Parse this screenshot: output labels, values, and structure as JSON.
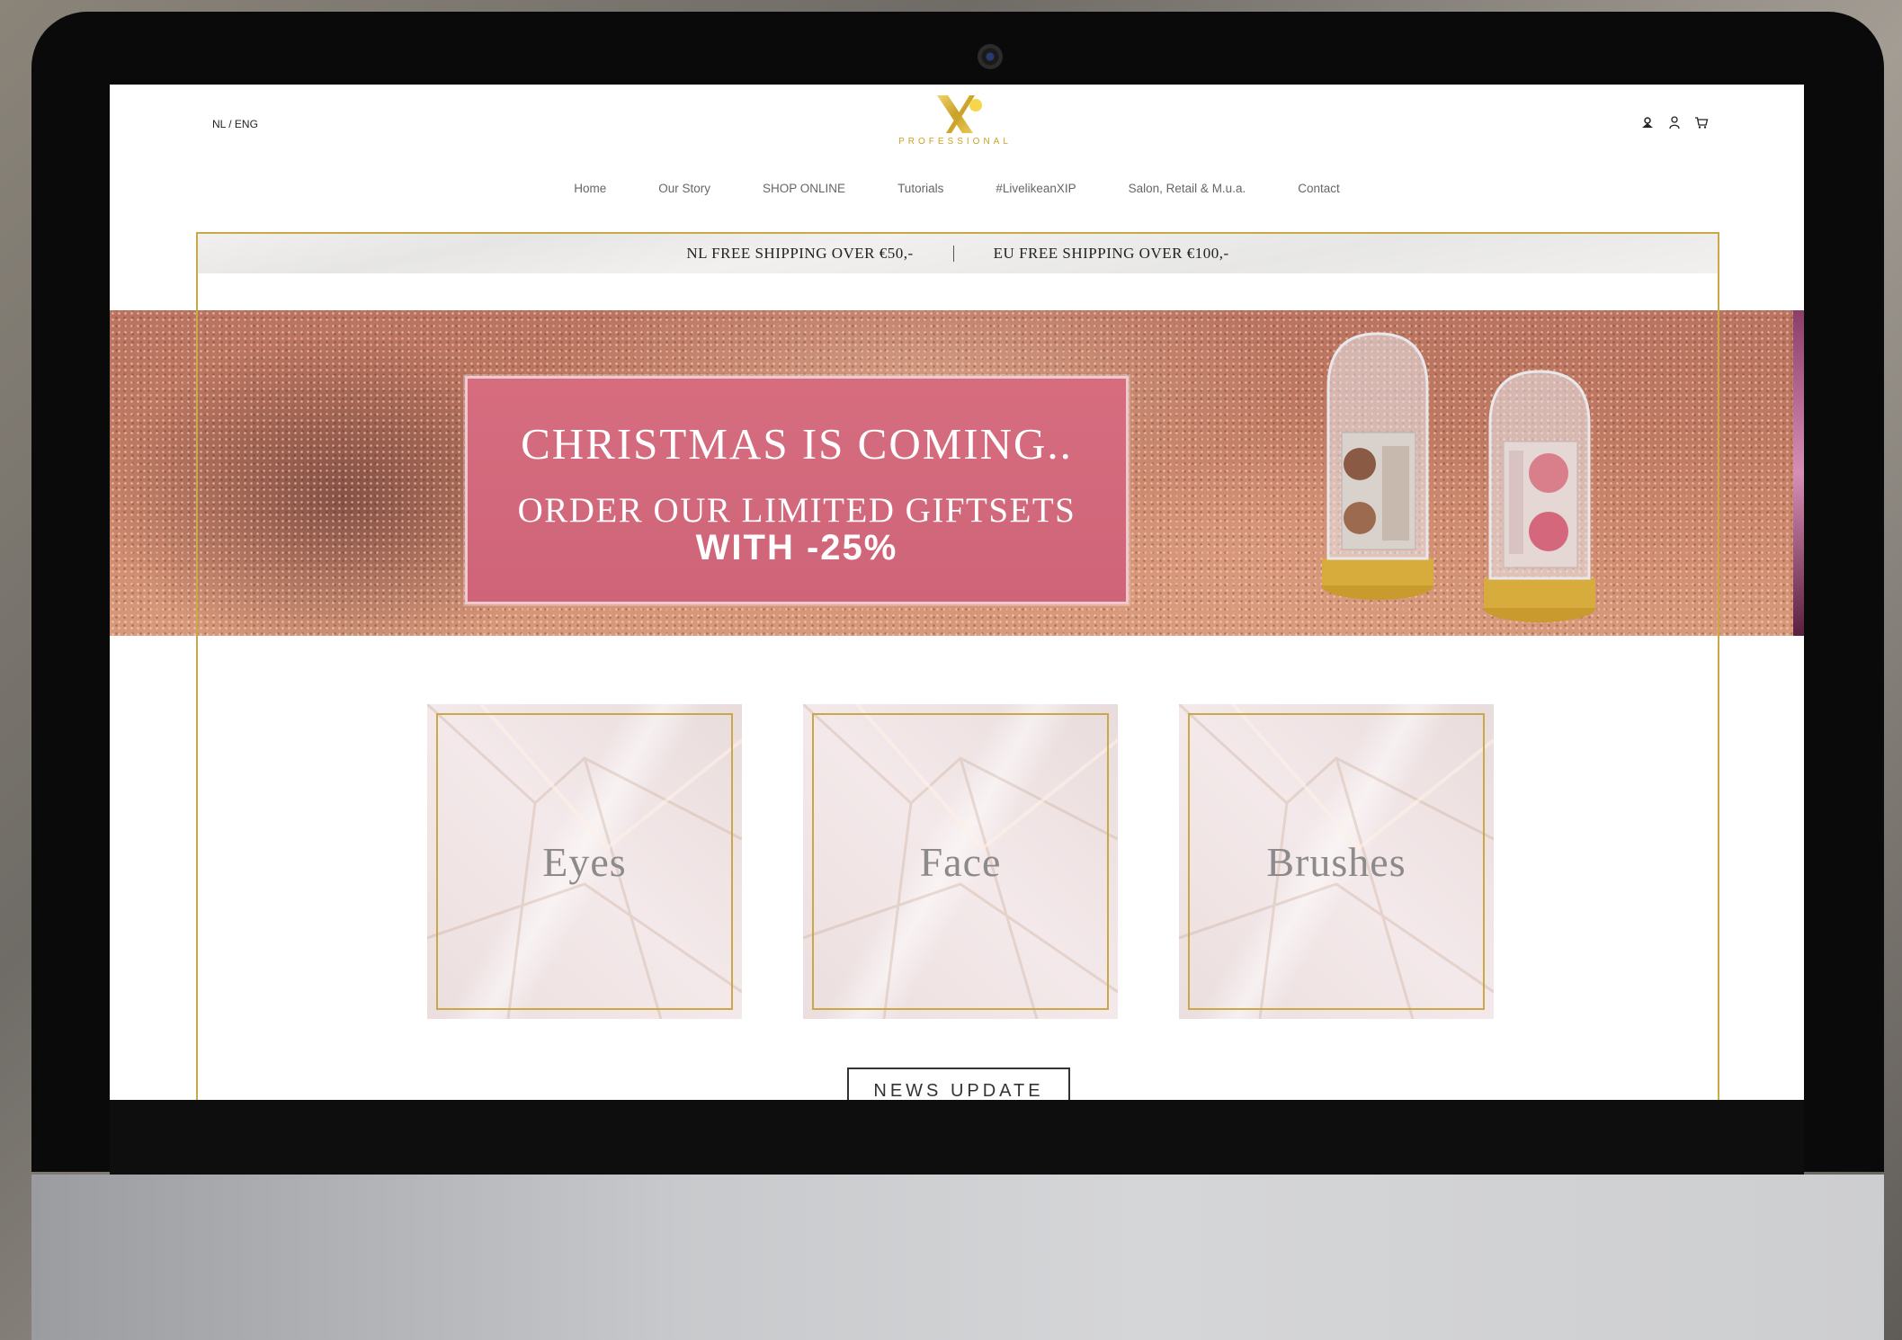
{
  "header": {
    "language_switch": "NL / ENG",
    "logo_mark": "X",
    "logo_text": "PROFESSIONAL"
  },
  "nav": {
    "items": [
      "Home",
      "Our Story",
      "SHOP ONLINE",
      "Tutorials",
      "#LivelikeanXIP",
      "Salon, Retail & M.u.a.",
      "Contact"
    ]
  },
  "shipping": {
    "nl": "NL FREE SHIPPING OVER €50,-",
    "eu": "EU FREE SHIPPING OVER €100,-"
  },
  "banner": {
    "line1": "CHRISTMAS IS COMING..",
    "line2": "ORDER OUR LIMITED GIFTSETS",
    "line3": "WITH -25%"
  },
  "categories": [
    "Eyes",
    "Face",
    "Brushes"
  ],
  "news_button": "NEWS UPDATE",
  "icons": [
    "account-icon",
    "user-icon",
    "cart-icon"
  ],
  "colors": {
    "gold": "#c9a84a",
    "promo_pink": "#d66d7f",
    "tile_bg": "#f4e9ea"
  }
}
